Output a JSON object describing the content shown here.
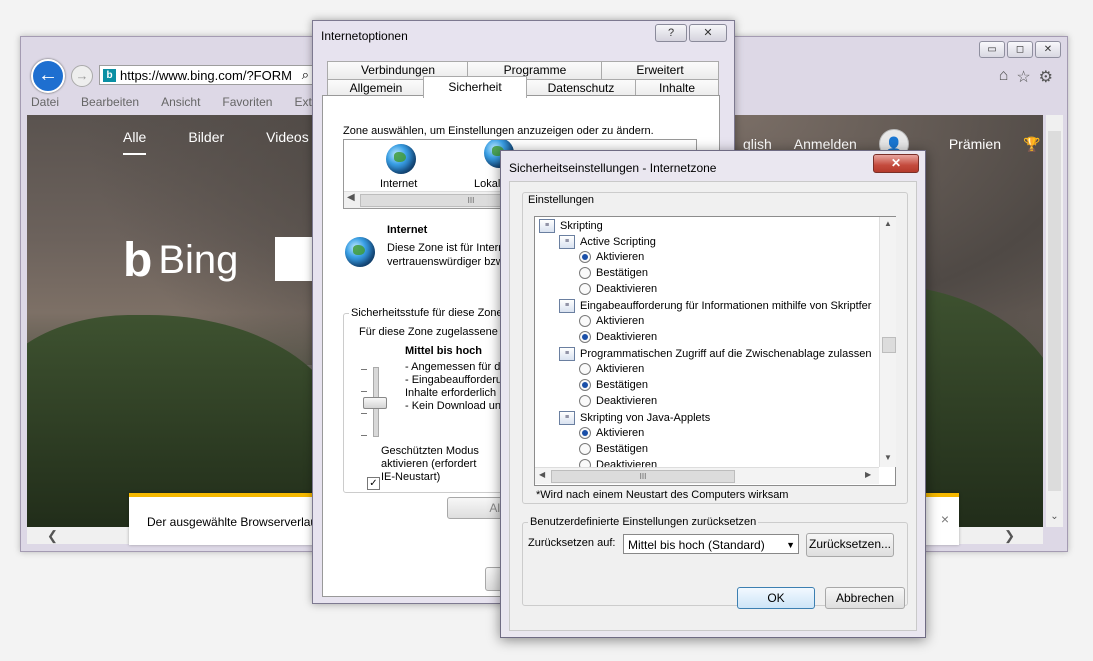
{
  "browser": {
    "url": "https://www.bing.com/?FORM",
    "menu": [
      "Datei",
      "Bearbeiten",
      "Ansicht",
      "Favoriten",
      "Extras"
    ],
    "window_buttons": [
      "▭",
      "◻",
      "✕"
    ],
    "toolbar_icons": [
      "⌂",
      "☆",
      "⚙"
    ],
    "bing": {
      "nav": [
        "Alle",
        "Bilder",
        "Videos"
      ],
      "logo": "Bing",
      "logo_mark": "b",
      "right_nav": [
        "glish",
        "Anmelden",
        "Prämien"
      ],
      "avatar_glyph": "👤",
      "trophy_glyph": "🏆",
      "menu_glyph": "☰"
    },
    "notification": "Der ausgewählte Browserverlauf",
    "notification_close": "×",
    "scroll_left": "❮",
    "scroll_right": "❯",
    "scroll_down": "⌄"
  },
  "internetoptionen": {
    "title": "Internetoptionen",
    "help": "?",
    "close": "✕",
    "tabs_row1": [
      "Verbindungen",
      "Programme",
      "Erweitert"
    ],
    "tabs_row2": [
      "Allgemein",
      "Sicherheit",
      "Datenschutz",
      "Inhalte"
    ],
    "zone_prompt": "Zone auswählen, um Einstellungen anzuzeigen oder zu ändern.",
    "zones": [
      "Internet",
      "Lokal"
    ],
    "zone_name": "Internet",
    "zone_desc_1": "Diese Zone ist für Intern",
    "zone_desc_2": "vertrauenswürdiger bzw",
    "level_group": "Sicherheitsstufe für diese Zone",
    "allowed_levels": "Für diese Zone zugelassene S",
    "level_name": "Mittel bis hoch",
    "level_lines": [
      "- Angemessen für d",
      "- Eingabeaufforderu",
      "Inhalte erforderlich",
      "- Kein Download uns"
    ],
    "protected_mode": [
      "Geschützten Modus",
      "aktivieren (erfordert",
      "IE-Neustart)"
    ],
    "protected_checked": "✓",
    "all_zones_btn": "Alle Zo",
    "scroll_grip": "III"
  },
  "sicherheit": {
    "title": "Sicherheitseinstellungen - Internetzone",
    "close": "✕",
    "settings_label": "Einstellungen",
    "items": [
      {
        "type": "header",
        "label": "Skripting",
        "indent": 0
      },
      {
        "type": "setting",
        "label": "Active Scripting",
        "indent": 1
      },
      {
        "type": "option",
        "label": "Aktivieren",
        "checked": true
      },
      {
        "type": "option",
        "label": "Bestätigen",
        "checked": false
      },
      {
        "type": "option",
        "label": "Deaktivieren",
        "checked": false
      },
      {
        "type": "setting",
        "label": "Eingabeaufforderung für Informationen mithilfe von Skriptfer",
        "indent": 1
      },
      {
        "type": "option",
        "label": "Aktivieren",
        "checked": false
      },
      {
        "type": "option",
        "label": "Deaktivieren",
        "checked": true
      },
      {
        "type": "setting",
        "label": "Programmatischen Zugriff auf die Zwischenablage zulassen",
        "indent": 1
      },
      {
        "type": "option",
        "label": "Aktivieren",
        "checked": false
      },
      {
        "type": "option",
        "label": "Bestätigen",
        "checked": true
      },
      {
        "type": "option",
        "label": "Deaktivieren",
        "checked": false
      },
      {
        "type": "setting",
        "label": "Skripting von Java-Applets",
        "indent": 1
      },
      {
        "type": "option",
        "label": "Aktivieren",
        "checked": true
      },
      {
        "type": "option",
        "label": "Bestätigen",
        "checked": false
      },
      {
        "type": "option",
        "label": "Deaktivieren",
        "checked": false
      }
    ],
    "restart_note": "*Wird nach einem Neustart des Computers wirksam",
    "reset_group": "Benutzerdefinierte Einstellungen zurücksetzen",
    "reset_to_label": "Zurücksetzen auf:",
    "reset_value": "Mittel bis hoch (Standard)",
    "reset_btn": "Zurücksetzen...",
    "ok": "OK",
    "cancel": "Abbrechen",
    "scroll_up": "▲",
    "scroll_down": "▼",
    "scroll_left": "◀",
    "scroll_right": "▶",
    "grip": "III"
  }
}
